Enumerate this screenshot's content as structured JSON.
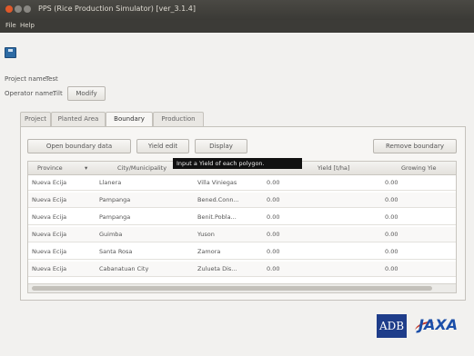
{
  "window": {
    "title": "PPS (Rice Production Simulator) [ver_3.1.4]"
  },
  "menu": [
    {
      "label": "File"
    },
    {
      "label": "Help"
    }
  ],
  "project": {
    "name_label": "Project name:",
    "name_value": "Test",
    "operator_label": "Operator name:",
    "operator_value": "Tilt",
    "modify_label": "Modify"
  },
  "tabs": [
    {
      "label": "Project"
    },
    {
      "label": "Planted Area"
    },
    {
      "label": "Boundary"
    },
    {
      "label": "Production"
    }
  ],
  "toolbar": {
    "open_label": "Open boundary data",
    "yield_label": "Yield edit",
    "display_label": "Display",
    "remove_label": "Remove boundary"
  },
  "tooltip": "Input a Yield of each polygon.",
  "table": {
    "columns": [
      "Province",
      "City/Municipality",
      "",
      "Yield [t/ha]",
      "Growing Yie"
    ],
    "rows": [
      [
        "Nueva Ecija",
        "Llanera",
        "Villa Viniegas",
        "0.00",
        "0.00"
      ],
      [
        "Nueva Ecija",
        "Pampanga",
        "Bened.Conn...",
        "0.00",
        "0.00"
      ],
      [
        "Nueva Ecija",
        "Pampanga",
        "Benit.Pobla...",
        "0.00",
        "0.00"
      ],
      [
        "Nueva Ecija",
        "Guimba",
        "Yuson",
        "0.00",
        "0.00"
      ],
      [
        "Nueva Ecija",
        "Santa Rosa",
        "Zamora",
        "0.00",
        "0.00"
      ],
      [
        "Nueva Ecija",
        "Cabanatuan City",
        "Zulueta Dis...",
        "0.00",
        "0.00"
      ]
    ]
  },
  "logos": {
    "adb": "ADB",
    "jaxa": "JAXA"
  }
}
